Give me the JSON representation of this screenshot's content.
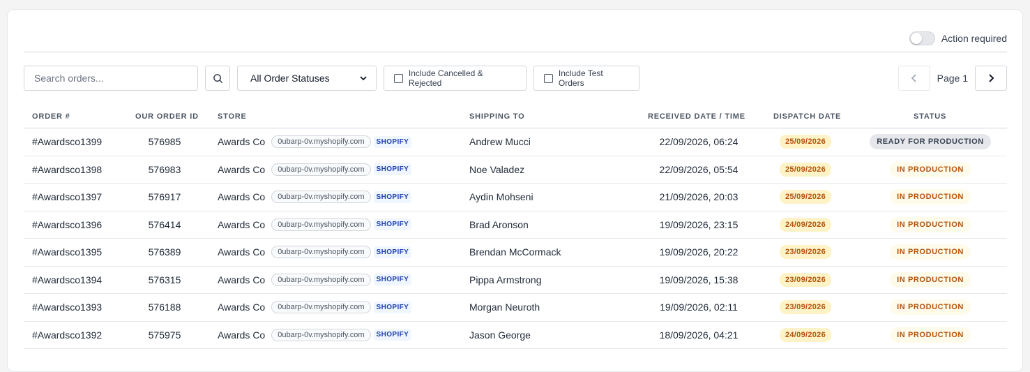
{
  "header": {
    "action_required_label": "Action required",
    "action_required_on": false
  },
  "filters": {
    "search_placeholder": "Search orders...",
    "search_value": "",
    "status_select": "All Order Statuses",
    "include_cancelled_label": "Include Cancelled & Rejected",
    "include_cancelled_checked": false,
    "include_test_label": "Include Test Orders",
    "include_test_checked": false
  },
  "pagination": {
    "label": "Page 1"
  },
  "table": {
    "columns": [
      "ORDER #",
      "OUR ORDER ID",
      "STORE",
      "SHIPPING TO",
      "RECEIVED DATE / TIME",
      "DISPATCH DATE",
      "STATUS"
    ],
    "rows": [
      {
        "order": "#Awardsco1399",
        "id": "576985",
        "store": "Awards Co",
        "domain": "0ubarp-0v.myshopify.com",
        "platform": "SHOPIFY",
        "ship_to": "Andrew Mucci",
        "received": "22/09/2026, 06:24",
        "dispatch": "25/09/2026",
        "status": "READY FOR PRODUCTION",
        "status_kind": "ready"
      },
      {
        "order": "#Awardsco1398",
        "id": "576983",
        "store": "Awards Co",
        "domain": "0ubarp-0v.myshopify.com",
        "platform": "SHOPIFY",
        "ship_to": "Noe Valadez",
        "received": "22/09/2026, 05:54",
        "dispatch": "25/09/2026",
        "status": "IN PRODUCTION",
        "status_kind": "prod"
      },
      {
        "order": "#Awardsco1397",
        "id": "576917",
        "store": "Awards Co",
        "domain": "0ubarp-0v.myshopify.com",
        "platform": "SHOPIFY",
        "ship_to": "Aydin Mohseni",
        "received": "21/09/2026, 20:03",
        "dispatch": "25/09/2026",
        "status": "IN PRODUCTION",
        "status_kind": "prod"
      },
      {
        "order": "#Awardsco1396",
        "id": "576414",
        "store": "Awards Co",
        "domain": "0ubarp-0v.myshopify.com",
        "platform": "SHOPIFY",
        "ship_to": "Brad Aronson",
        "received": "19/09/2026, 23:15",
        "dispatch": "24/09/2026",
        "status": "IN PRODUCTION",
        "status_kind": "prod"
      },
      {
        "order": "#Awardsco1395",
        "id": "576389",
        "store": "Awards Co",
        "domain": "0ubarp-0v.myshopify.com",
        "platform": "SHOPIFY",
        "ship_to": "Brendan McCormack",
        "received": "19/09/2026, 20:22",
        "dispatch": "23/09/2026",
        "status": "IN PRODUCTION",
        "status_kind": "prod"
      },
      {
        "order": "#Awardsco1394",
        "id": "576315",
        "store": "Awards Co",
        "domain": "0ubarp-0v.myshopify.com",
        "platform": "SHOPIFY",
        "ship_to": "Pippa Armstrong",
        "received": "19/09/2026, 15:38",
        "dispatch": "23/09/2026",
        "status": "IN PRODUCTION",
        "status_kind": "prod"
      },
      {
        "order": "#Awardsco1393",
        "id": "576188",
        "store": "Awards Co",
        "domain": "0ubarp-0v.myshopify.com",
        "platform": "SHOPIFY",
        "ship_to": "Morgan Neuroth",
        "received": "19/09/2026, 02:11",
        "dispatch": "23/09/2026",
        "status": "IN PRODUCTION",
        "status_kind": "prod"
      },
      {
        "order": "#Awardsco1392",
        "id": "575975",
        "store": "Awards Co",
        "domain": "0ubarp-0v.myshopify.com",
        "platform": "SHOPIFY",
        "ship_to": "Jason George",
        "received": "18/09/2026, 04:21",
        "dispatch": "24/09/2026",
        "status": "IN PRODUCTION",
        "status_kind": "prod"
      }
    ]
  }
}
